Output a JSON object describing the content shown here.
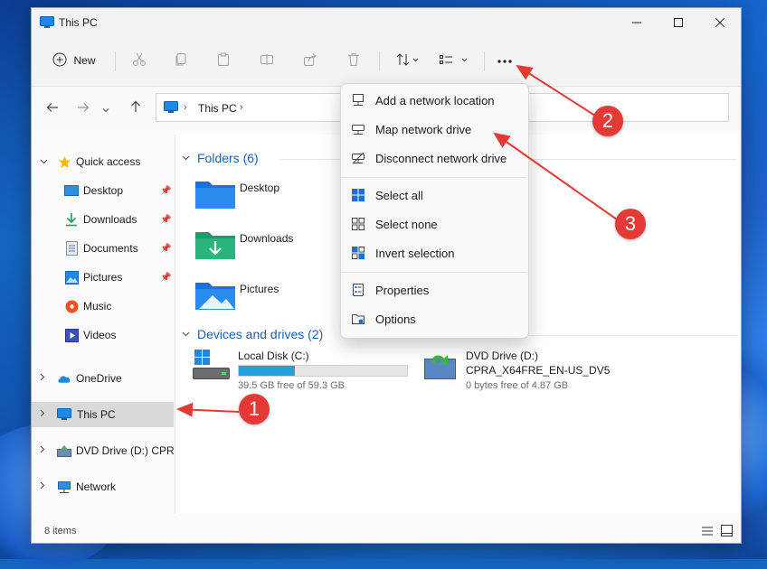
{
  "window": {
    "title": "This PC"
  },
  "toolbar": {
    "new_label": "New"
  },
  "address": {
    "location": "This PC"
  },
  "sidebar": {
    "items": [
      {
        "label": "Quick access"
      },
      {
        "label": "Desktop"
      },
      {
        "label": "Downloads"
      },
      {
        "label": "Documents"
      },
      {
        "label": "Pictures"
      },
      {
        "label": "Music"
      },
      {
        "label": "Videos"
      },
      {
        "label": "OneDrive"
      },
      {
        "label": "This PC"
      },
      {
        "label": "DVD Drive (D:) CPRA"
      },
      {
        "label": "Network"
      }
    ]
  },
  "content": {
    "folders_header": "Folders (6)",
    "folders": [
      "Desktop",
      "Downloads",
      "Pictures"
    ],
    "drives_header": "Devices and drives (2)",
    "drives": [
      {
        "name": "Local Disk (C:)",
        "free_text": "39.5 GB free of 59.3 GB",
        "used_fraction": 0.334
      },
      {
        "name": "DVD Drive (D:)",
        "volume": "CPRA_X64FRE_EN-US_DV5",
        "free_text": "0 bytes free of 4.87 GB"
      }
    ]
  },
  "menu": {
    "items": [
      {
        "label": "Add a network location"
      },
      {
        "label": "Map network drive"
      },
      {
        "label": "Disconnect network drive"
      },
      {
        "label": "Select all"
      },
      {
        "label": "Select none"
      },
      {
        "label": "Invert selection"
      },
      {
        "label": "Properties"
      },
      {
        "label": "Options"
      }
    ]
  },
  "status": {
    "items_count": "8 items"
  },
  "callouts": [
    "1",
    "2",
    "3"
  ],
  "colors": {
    "accent": "#26a0da",
    "callout": "#e53935",
    "header_blue": "#1f5fa8"
  }
}
